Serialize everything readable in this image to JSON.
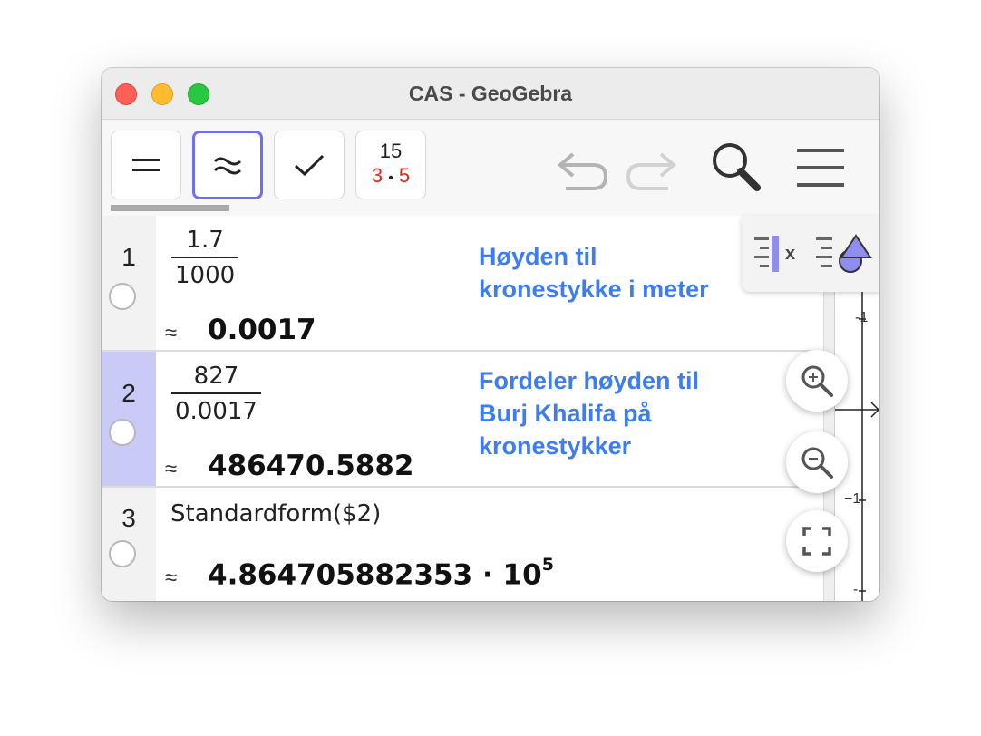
{
  "window": {
    "title": "CAS - GeoGebra"
  },
  "toolbar": {
    "evaluate_icon": "equals-icon",
    "numeric_icon": "approx-icon",
    "keep_input_icon": "checkmark-icon",
    "factor_top": "15",
    "factor_left": "3",
    "factor_dot": "•",
    "factor_right": "5",
    "undo_icon": "undo-icon",
    "redo_icon": "redo-icon",
    "search_icon": "search-icon",
    "menu_icon": "hamburger-menu-icon"
  },
  "rows": [
    {
      "number": "1",
      "numerator": "1.7",
      "denominator": "1000",
      "approx": "≈",
      "result": "0.0017",
      "note_line1": "Høyden til",
      "note_line2": "kronestykke i meter"
    },
    {
      "number": "2",
      "numerator": "827",
      "denominator": "0.0017",
      "approx": "≈",
      "result": "486470.5882",
      "note_line1": "Fordeler høyden til",
      "note_line2": "Burj Khalifa på",
      "note_line3": "kronestykker"
    },
    {
      "number": "3",
      "input": "Standardform($2)",
      "approx": "≈",
      "result_mantissa": "4.864705882353 · 10",
      "result_exponent": "5"
    }
  ],
  "graphics": {
    "tick_top": "-1",
    "tick_mid": "−1",
    "tick_bottom": "-"
  },
  "colors": {
    "accent": "#6f6ff2",
    "note_blue": "#3d7df1",
    "selected_row": "#c9caf6",
    "factor_red": "#e0251b"
  }
}
